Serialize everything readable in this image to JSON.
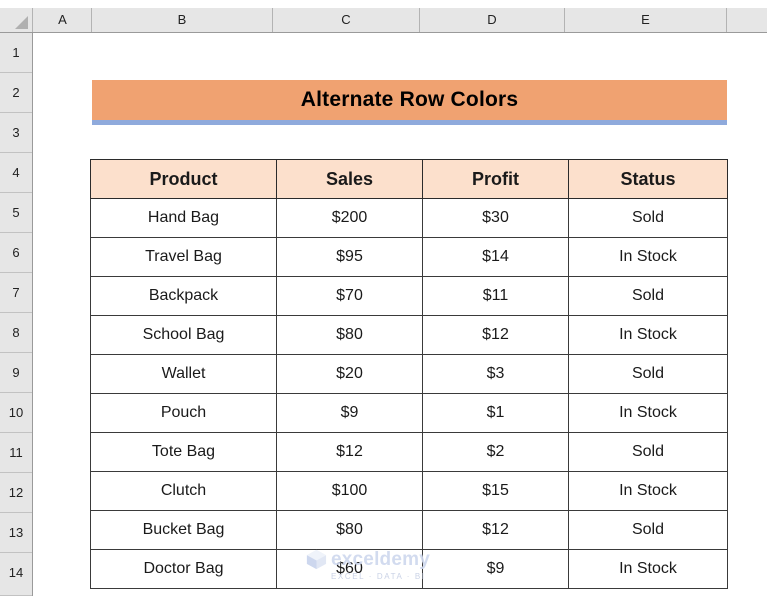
{
  "spreadsheet": {
    "column_headers": [
      "A",
      "B",
      "C",
      "D",
      "E"
    ],
    "row_numbers": [
      "1",
      "2",
      "3",
      "4",
      "5",
      "6",
      "7",
      "8",
      "9",
      "10",
      "11",
      "12",
      "13",
      "14"
    ],
    "select_all_name": "select-all-corner"
  },
  "title": {
    "text": "Alternate Row Colors",
    "background_color": "#F0A271",
    "underline_color": "#8FAADC",
    "text_color": "#000000"
  },
  "table": {
    "header_background": "#FCE0CC",
    "border_color": "#3A3A3A",
    "row_background": "#FFFFFF",
    "headers": [
      "Product",
      "Sales",
      "Profit",
      "Status"
    ],
    "rows": [
      {
        "product": "Hand Bag",
        "sales": "$200",
        "profit": "$30",
        "status": "Sold"
      },
      {
        "product": "Travel Bag",
        "sales": "$95",
        "profit": "$14",
        "status": "In Stock"
      },
      {
        "product": "Backpack",
        "sales": "$70",
        "profit": "$11",
        "status": "Sold"
      },
      {
        "product": "School Bag",
        "sales": "$80",
        "profit": "$12",
        "status": "In Stock"
      },
      {
        "product": "Wallet",
        "sales": "$20",
        "profit": "$3",
        "status": "Sold"
      },
      {
        "product": "Pouch",
        "sales": "$9",
        "profit": "$1",
        "status": "In Stock"
      },
      {
        "product": "Tote Bag",
        "sales": "$12",
        "profit": "$2",
        "status": "Sold"
      },
      {
        "product": "Clutch",
        "sales": "$100",
        "profit": "$15",
        "status": "In Stock"
      },
      {
        "product": "Bucket Bag",
        "sales": "$80",
        "profit": "$12",
        "status": "Sold"
      },
      {
        "product": "Doctor Bag",
        "sales": "$60",
        "profit": "$9",
        "status": "In Stock"
      }
    ]
  },
  "watermark": {
    "name": "exceldemy",
    "tagline": "EXCEL · DATA · BI",
    "color": "#CFD8EE"
  }
}
